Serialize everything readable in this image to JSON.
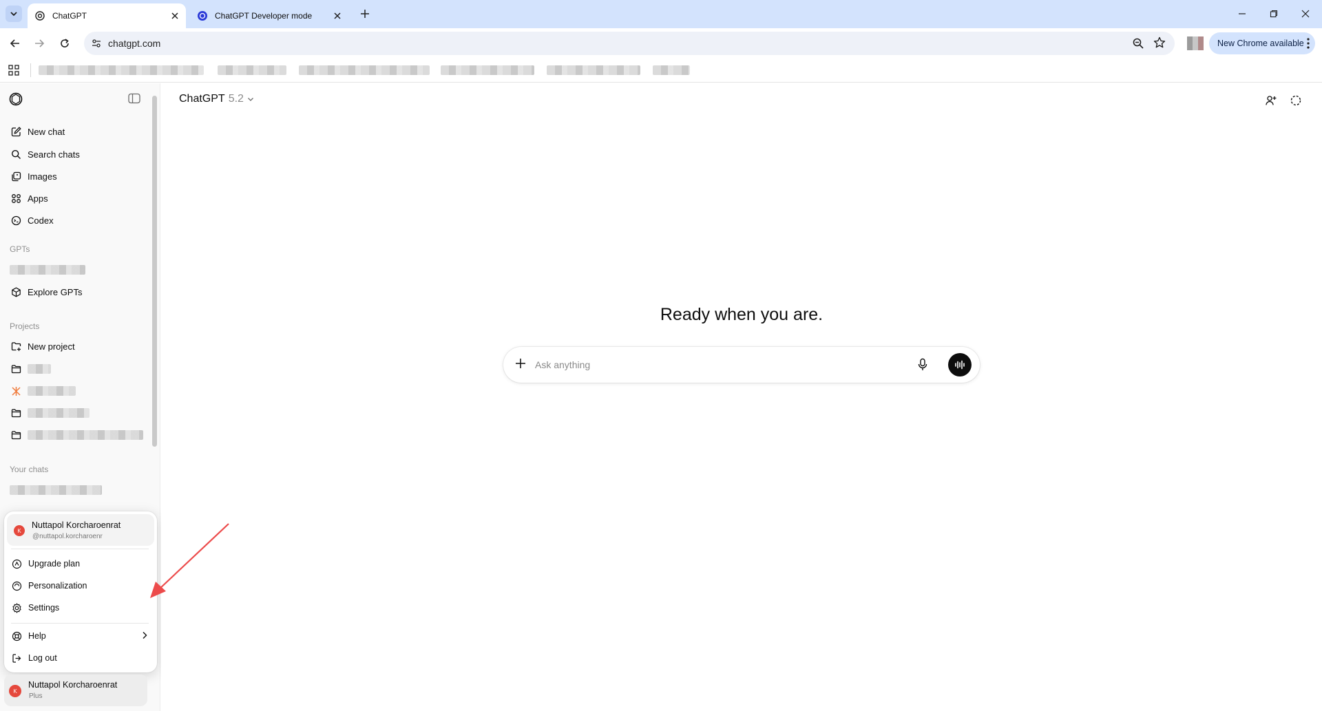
{
  "browser": {
    "tabs": [
      {
        "title": "ChatGPT",
        "active": true
      },
      {
        "title": "ChatGPT Developer mode",
        "active": false
      }
    ],
    "url": "chatgpt.com",
    "update_label": "New Chrome available"
  },
  "sidebar": {
    "nav": [
      {
        "label": "New chat",
        "icon": "edit-icon"
      },
      {
        "label": "Search chats",
        "icon": "search-icon"
      },
      {
        "label": "Images",
        "icon": "images-icon"
      },
      {
        "label": "Apps",
        "icon": "apps-icon"
      },
      {
        "label": "Codex",
        "icon": "codex-icon"
      }
    ],
    "gpts_heading": "GPTs",
    "explore_gpts": "Explore GPTs",
    "projects_heading": "Projects",
    "new_project": "New project",
    "your_chats_heading": "Your chats"
  },
  "account_menu": {
    "name": "Nuttapol Korcharoenrat",
    "handle": "@nuttapol.korcharoenr",
    "avatar_initial": "K",
    "items": [
      {
        "label": "Upgrade plan",
        "icon": "upgrade-icon"
      },
      {
        "label": "Personalization",
        "icon": "personalization-icon"
      },
      {
        "label": "Settings",
        "icon": "gear-icon"
      },
      {
        "label": "Help",
        "icon": "help-icon"
      },
      {
        "label": "Log out",
        "icon": "logout-icon"
      }
    ]
  },
  "profile": {
    "name": "Nuttapol Korcharoenrat",
    "plan": "Plus",
    "avatar_initial": "K"
  },
  "main": {
    "model_name": "ChatGPT",
    "model_version": "5.2",
    "hero": "Ready when you are.",
    "composer_placeholder": "Ask anything"
  },
  "colors": {
    "tabstrip": "#d3e3fd",
    "avatar": "#e5483c",
    "annotation_arrow": "#ec4b4b",
    "sidebar_bg": "#f9f9f9"
  }
}
